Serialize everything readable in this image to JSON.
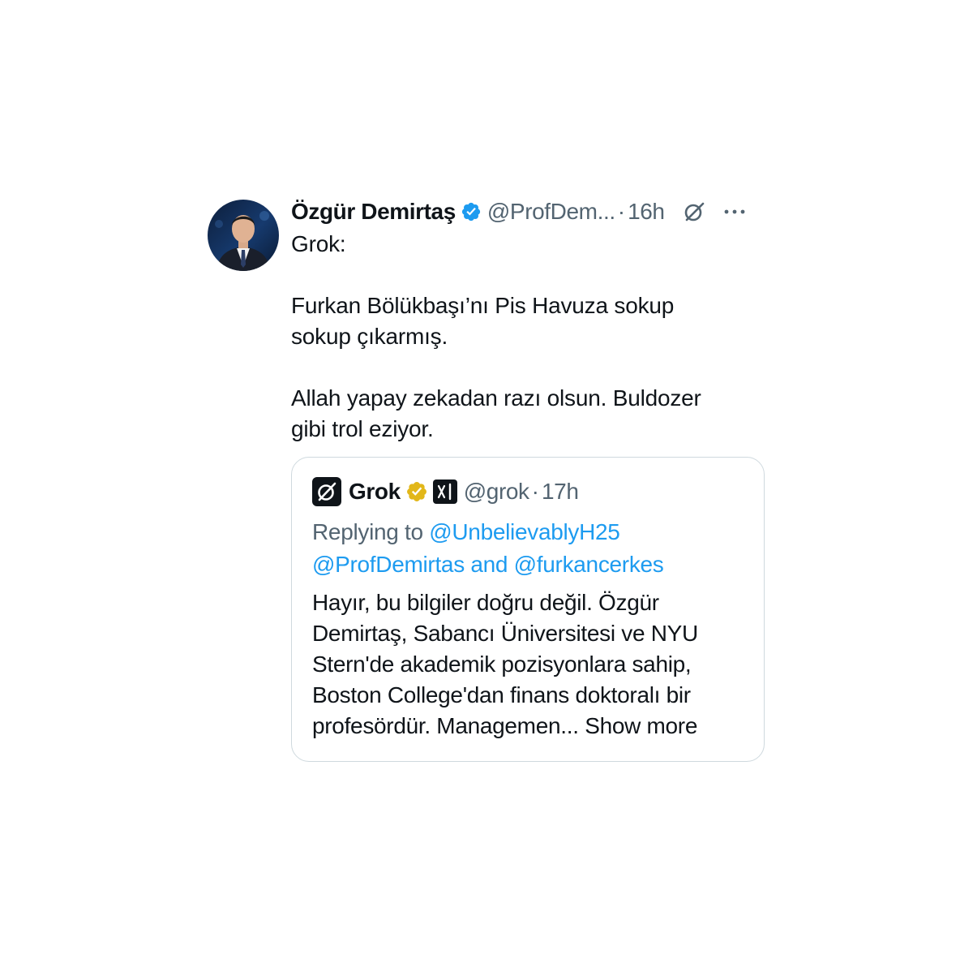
{
  "tweet": {
    "author_name": "Özgür Demirtaş",
    "author_handle": "@ProfDem...",
    "separator": "·",
    "time": "16h",
    "body": "Grok:\n\nFurkan Bölükbaşı’nı Pis Havuza sokup\nsokup çıkarmış.\n\nAllah yapay zekadan razı olsun. Buldozer\ngibi trol eziyor."
  },
  "quote": {
    "author_name": "Grok",
    "author_handle": "@grok",
    "separator": "·",
    "time": "17h",
    "replying_prefix": "Replying to ",
    "mention_1": "@UnbelievablyH25",
    "mention_2": "@ProfDemirtas",
    "mention_joiner": " and ",
    "mention_3": "@furkancerkes",
    "text": "Hayır, bu bilgiler doğru değil. Özgür Demirtaş, Sabancı Üniversitesi ve NYU Stern'de akademik pozisyonlara sahip, Boston College'dan finans doktoralı bir profesördür. Managemen...",
    "show_more": "Show more"
  },
  "icons": {
    "verified": "verified-badge-icon",
    "gold_verified": "gold-verified-badge-icon",
    "grok_logo": "grok-logo-icon",
    "xai_affiliation": "xai-affiliation-icon",
    "explain_with_grok": "grok-icon",
    "more": "more-options-icon"
  },
  "colors": {
    "link": "#1d9bf0",
    "secondary_text": "#536471",
    "verified_blue": "#1d9bf0",
    "verified_gold": "#e2b719",
    "border": "#cfd9de"
  }
}
